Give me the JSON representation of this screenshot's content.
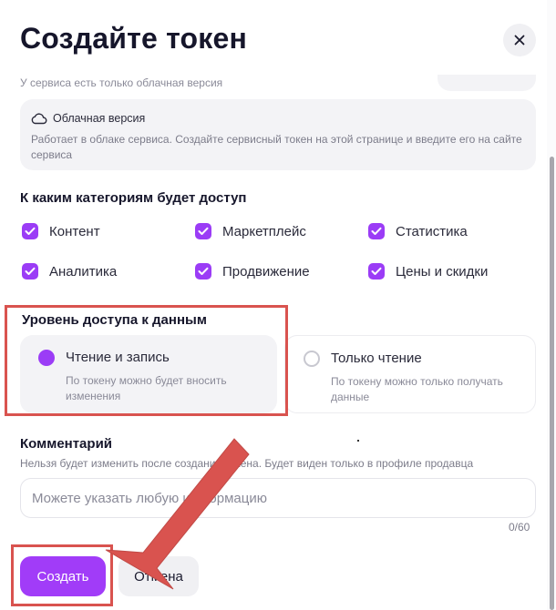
{
  "modal": {
    "title": "Создайте токен",
    "cut_text": "У сервиса есть только облачная версия"
  },
  "cloud_card": {
    "icon": "cloud-icon",
    "title": "Облачная версия",
    "description": "Работает в облаке сервиса. Создайте сервисный токен на этой странице и введите его на сайте сервиса"
  },
  "categories": {
    "label": "К каким категориям будет доступ",
    "items": [
      {
        "label": "Контент",
        "checked": true
      },
      {
        "label": "Маркетплейс",
        "checked": true
      },
      {
        "label": "Статистика",
        "checked": true
      },
      {
        "label": "Аналитика",
        "checked": true
      },
      {
        "label": "Продвижение",
        "checked": true
      },
      {
        "label": "Цены и скидки",
        "checked": true
      }
    ]
  },
  "access_level": {
    "label": "Уровень доступа к данным",
    "options": [
      {
        "title": "Чтение и запись",
        "description": "По токену можно будет вносить изменения",
        "selected": true
      },
      {
        "title": "Только чтение",
        "description": "По токену можно только получать данные",
        "selected": false
      }
    ]
  },
  "comment": {
    "label": "Комментарий",
    "hint": "Нельзя будет изменить после создания токена. Будет виден только в профиле продавца",
    "value": "",
    "placeholder": "Можете указать любую информацию",
    "counter": "0/60"
  },
  "buttons": {
    "create": "Создать",
    "cancel": "Отмена"
  },
  "colors": {
    "accent": "#a13cf8",
    "highlight": "#d9534f"
  }
}
